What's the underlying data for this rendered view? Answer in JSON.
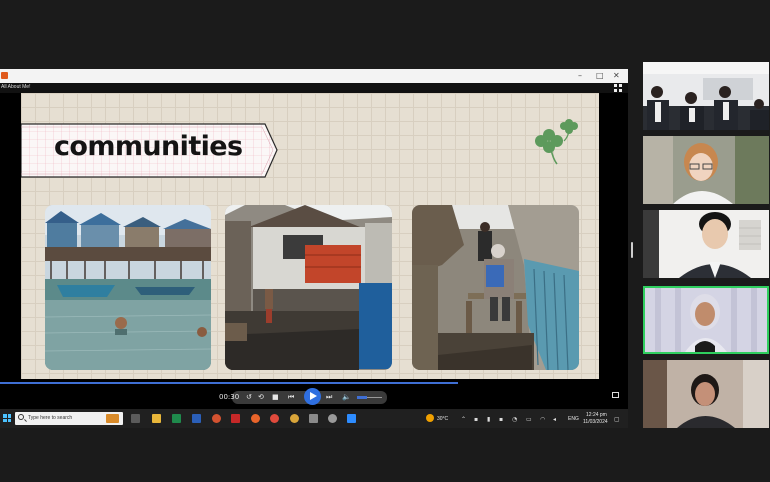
{
  "window": {
    "doc_title": "All About Me!",
    "controls": {
      "minimize": "–",
      "maximize": "□",
      "close": "✕"
    }
  },
  "slide": {
    "title": "communities",
    "decor_icon": "clover-icon",
    "photos": [
      {
        "name": "stilt-village-water-photo"
      },
      {
        "name": "slum-houses-photo"
      },
      {
        "name": "narrow-alley-photo"
      }
    ]
  },
  "player": {
    "time": "00:30",
    "progress_fraction": 0.73,
    "volume_fraction": 0.4,
    "icons": [
      "rewind-icon",
      "loop-icon",
      "stop-icon",
      "skip-back-icon",
      "play-icon",
      "skip-forward-icon",
      "volume-icon"
    ]
  },
  "taskbar": {
    "search_placeholder": "Type here to search",
    "weather": "30°C",
    "language": "ENG",
    "time": "12:24 pm",
    "date": "11/03/2024",
    "accent": "#4cc2ff"
  },
  "participants": [
    {
      "name": "participant-tile-group"
    },
    {
      "name": "participant-tile-woman-glasses"
    },
    {
      "name": "participant-tile-man-suit"
    },
    {
      "name": "participant-tile-woman-hijab",
      "active_speaker": true,
      "highlight": "#2fcf5f"
    },
    {
      "name": "participant-tile-woman-room"
    }
  ]
}
